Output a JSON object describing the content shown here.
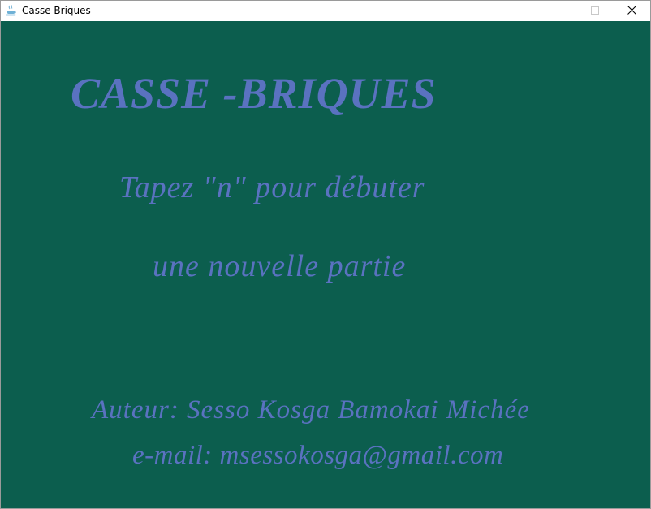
{
  "window": {
    "title": "Casse Briques",
    "app_icon": "java-cup-icon",
    "controls": {
      "minimize": "minimize-icon",
      "maximize": "maximize-icon",
      "close": "close-icon"
    }
  },
  "game": {
    "background_color": "#0c5e4e",
    "text_color": "#5a72c0",
    "title": "CASSE -BRIQUES",
    "instruction_line1": "Tapez \"n\" pour débuter",
    "instruction_line2": "une nouvelle partie",
    "author_line": "Auteur: Sesso Kosga Bamokai Michée",
    "email_line": "e-mail: msessokosga@gmail.com"
  }
}
